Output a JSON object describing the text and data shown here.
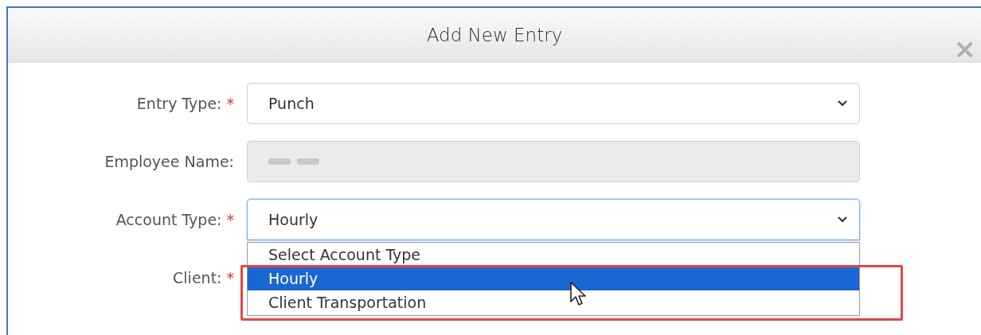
{
  "modal": {
    "title": "Add New Entry",
    "close": "×"
  },
  "fields": [
    {
      "label": "Entry Type:",
      "required_mark": "*",
      "kind": "select",
      "value": "Punch",
      "disabled": false,
      "focused": false
    },
    {
      "label": "Employee Name:",
      "kind": "text",
      "redacted": true,
      "disabled": true,
      "focused": false
    },
    {
      "label": "Account Type:",
      "required_mark": "*",
      "kind": "select",
      "value": "Hourly",
      "disabled": false,
      "focused": true,
      "expanded": true
    },
    {
      "label": "Client:",
      "required_mark": "*"
    }
  ],
  "dropdown": {
    "options": [
      {
        "label": "Select Account Type",
        "selected": false
      },
      {
        "label": "Hourly",
        "selected": true
      },
      {
        "label": "Client Transportation",
        "selected": false
      }
    ]
  }
}
